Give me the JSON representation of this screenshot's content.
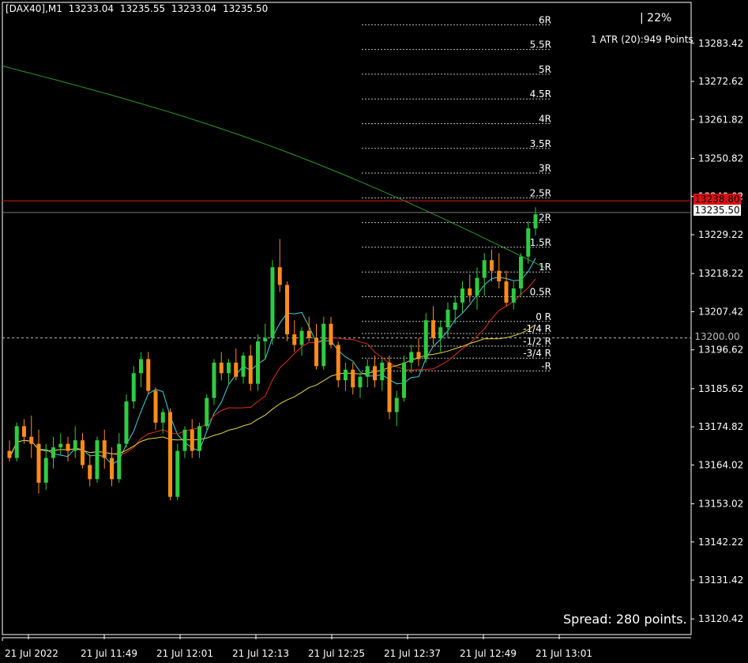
{
  "header": {
    "symbol": "[DAX40],M1",
    "open": "13233.04",
    "high": "13235.55",
    "low": "13233.04",
    "close": "13235.50"
  },
  "overlay": {
    "percent": "| 22%",
    "atr": "1 ATR (20):949 Points",
    "spread": "Spread: 280 points."
  },
  "price_tags": {
    "red_line": "13238.80",
    "current": "13235.50",
    "dashed_line": "13200.00"
  },
  "colors": {
    "background": "#000000",
    "bull_candle": "#2ecc40",
    "bear_candle": "#ff8c1a",
    "ma_fast": "#3fd3e0",
    "ma_mid": "#e0301e",
    "ma_slow": "#e8d84a",
    "ma_long": "#2a9a2a",
    "red_level": "#e01010",
    "grid_text": "#ffffff"
  },
  "chart_data": {
    "type": "candlestick",
    "title": "[DAX40],M1",
    "ylim": [
      13120.42,
      13283.42
    ],
    "yticks": [
      "13283.42",
      "13272.62",
      "13261.82",
      "13250.82",
      "13240.02",
      "13229.22",
      "13218.22",
      "13207.42",
      "13196.62",
      "13185.62",
      "13174.82",
      "13164.02",
      "13153.02",
      "13142.22",
      "13131.42",
      "13120.42"
    ],
    "xticks": [
      "21 Jul 2022",
      "21 Jul 11:49",
      "21 Jul 12:01",
      "21 Jul 12:13",
      "21 Jul 12:25",
      "21 Jul 12:37",
      "21 Jul 12:49",
      "21 Jul 13:01"
    ],
    "r_levels": [
      {
        "label": "6R",
        "price": 13290.0
      },
      {
        "label": "5.5R",
        "price": 13283.0
      },
      {
        "label": "5R",
        "price": 13276.0
      },
      {
        "label": "4.5R",
        "price": 13269.0
      },
      {
        "label": "4R",
        "price": 13262.0
      },
      {
        "label": "3.5R",
        "price": 13255.0
      },
      {
        "label": "3R",
        "price": 13248.0
      },
      {
        "label": "2.5R",
        "price": 13241.0
      },
      {
        "label": "2R",
        "price": 13234.0
      },
      {
        "label": "1.5R",
        "price": 13227.0
      },
      {
        "label": "1R",
        "price": 13220.0
      },
      {
        "label": "0.5R",
        "price": 13213.0
      },
      {
        "label": "0 R",
        "price": 13206.0
      },
      {
        "label": "-1/4 R",
        "price": 13202.6
      },
      {
        "label": "-1/2 R",
        "price": 13199.0
      },
      {
        "label": "-3/4 R",
        "price": 13195.6
      },
      {
        "label": "-R",
        "price": 13192.0
      }
    ],
    "red_level": 13238.8,
    "current_price": 13235.5,
    "dashed_level": 13200.0,
    "candles": [
      [
        13168,
        13171,
        13165,
        13166
      ],
      [
        13166,
        13176,
        13165,
        13175
      ],
      [
        13175,
        13177,
        13170,
        13172
      ],
      [
        13172,
        13178,
        13166,
        13170
      ],
      [
        13170,
        13174,
        13156,
        13159
      ],
      [
        13159,
        13170,
        13157,
        13166
      ],
      [
        13166,
        13172,
        13163,
        13169
      ],
      [
        13169,
        13173,
        13167,
        13170
      ],
      [
        13170,
        13172,
        13165,
        13168
      ],
      [
        13168,
        13175,
        13166,
        13171
      ],
      [
        13171,
        13173,
        13163,
        13164
      ],
      [
        13164,
        13167,
        13158,
        13160
      ],
      [
        13160,
        13172,
        13159,
        13171
      ],
      [
        13171,
        13174,
        13163,
        13166
      ],
      [
        13166,
        13169,
        13158,
        13160
      ],
      [
        13160,
        13173,
        13159,
        13170
      ],
      [
        13170,
        13184,
        13169,
        13182
      ],
      [
        13182,
        13192,
        13180,
        13190
      ],
      [
        13190,
        13196,
        13186,
        13194
      ],
      [
        13194,
        13196,
        13184,
        13185
      ],
      [
        13185,
        13186,
        13174,
        13176
      ],
      [
        13176,
        13180,
        13173,
        13179
      ],
      [
        13179,
        13180,
        13154,
        13155
      ],
      [
        13155,
        13170,
        13154,
        13168
      ],
      [
        13168,
        13175,
        13166,
        13174
      ],
      [
        13174,
        13177,
        13166,
        13168
      ],
      [
        13168,
        13176,
        13166,
        13175
      ],
      [
        13175,
        13184,
        13174,
        13183
      ],
      [
        13183,
        13194,
        13181,
        13193
      ],
      [
        13193,
        13196,
        13188,
        13190
      ],
      [
        13190,
        13194,
        13187,
        13193
      ],
      [
        13193,
        13197,
        13188,
        13189
      ],
      [
        13189,
        13196,
        13187,
        13195
      ],
      [
        13195,
        13198,
        13185,
        13187
      ],
      [
        13187,
        13201,
        13185,
        13199
      ],
      [
        13199,
        13204,
        13194,
        13200
      ],
      [
        13200,
        13222,
        13198,
        13220
      ],
      [
        13220,
        13228,
        13213,
        13215
      ],
      [
        13215,
        13216,
        13199,
        13201
      ],
      [
        13201,
        13205,
        13196,
        13198
      ],
      [
        13198,
        13203,
        13195,
        13202
      ],
      [
        13202,
        13206,
        13199,
        13200
      ],
      [
        13200,
        13204,
        13191,
        13192
      ],
      [
        13192,
        13206,
        13191,
        13204
      ],
      [
        13204,
        13206,
        13197,
        13198
      ],
      [
        13198,
        13199,
        13186,
        13188
      ],
      [
        13188,
        13193,
        13185,
        13191
      ],
      [
        13191,
        13193,
        13184,
        13186
      ],
      [
        13186,
        13190,
        13183,
        13189
      ],
      [
        13189,
        13194,
        13186,
        13192
      ],
      [
        13192,
        13195,
        13186,
        13188
      ],
      [
        13188,
        13194,
        13185,
        13193
      ],
      [
        13193,
        13195,
        13177,
        13179
      ],
      [
        13179,
        13185,
        13175,
        13183
      ],
      [
        13183,
        13195,
        13182,
        13193
      ],
      [
        13193,
        13198,
        13190,
        13196
      ],
      [
        13196,
        13200,
        13192,
        13194
      ],
      [
        13194,
        13207,
        13193,
        13205
      ],
      [
        13205,
        13209,
        13198,
        13200
      ],
      [
        13200,
        13205,
        13196,
        13203
      ],
      [
        13203,
        13210,
        13200,
        13208
      ],
      [
        13208,
        13212,
        13204,
        13210
      ],
      [
        13210,
        13216,
        13207,
        13214
      ],
      [
        13214,
        13218,
        13210,
        13212
      ],
      [
        13212,
        13220,
        13208,
        13217
      ],
      [
        13217,
        13224,
        13212,
        13222
      ],
      [
        13222,
        13225,
        13216,
        13219
      ],
      [
        13219,
        13224,
        13214,
        13216
      ],
      [
        13216,
        13219,
        13209,
        13210
      ],
      [
        13210,
        13216,
        13208,
        13214
      ],
      [
        13214,
        13224,
        13212,
        13223
      ],
      [
        13223,
        13233,
        13221,
        13231
      ],
      [
        13231,
        13237,
        13229,
        13235
      ]
    ]
  }
}
